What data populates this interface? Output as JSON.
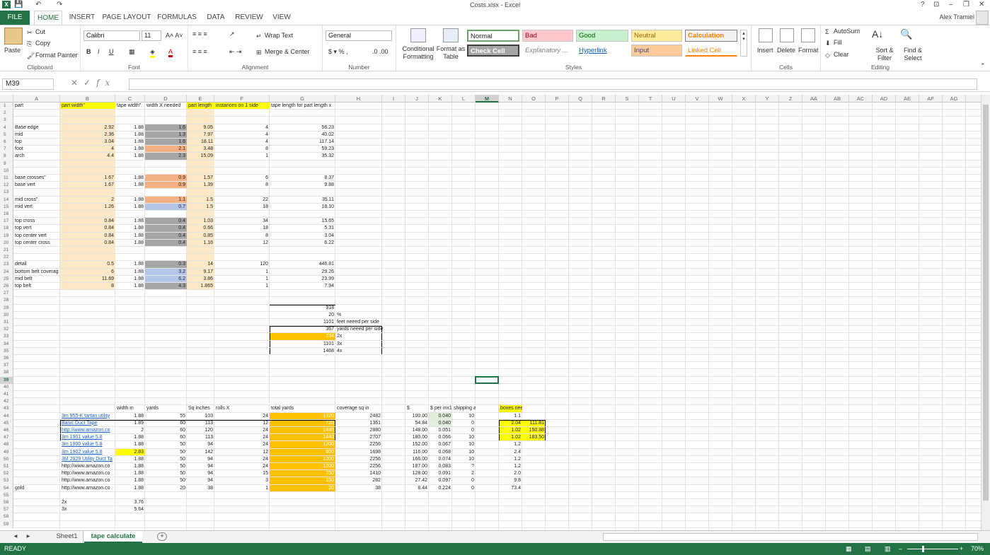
{
  "window": {
    "title": "Costs.xlsx - Excel",
    "help": "?",
    "restore": "⊡",
    "minimize": "–",
    "maximize": "❐",
    "close": "✕"
  },
  "qat": {
    "save": "💾",
    "undo": "↶",
    "redo": "↷"
  },
  "tabs": [
    "FILE",
    "HOME",
    "INSERT",
    "PAGE LAYOUT",
    "FORMULAS",
    "DATA",
    "REVIEW",
    "VIEW"
  ],
  "user": "Alex Tramiel",
  "ribbon": {
    "clipboard": {
      "label": "Clipboard",
      "paste": "Paste",
      "cut": "Cut",
      "copy": "Copy",
      "painter": "Format Painter"
    },
    "font": {
      "label": "Font",
      "name": "Calibri",
      "size": "11"
    },
    "alignment": {
      "label": "Alignment",
      "wrap": "Wrap Text",
      "merge": "Merge & Center"
    },
    "number": {
      "label": "Number",
      "format": "General"
    },
    "styles": {
      "label": "Styles",
      "cond": "Conditional Formatting",
      "table": "Format as Table",
      "normal": "Normal",
      "bad": "Bad",
      "good": "Good",
      "neutral": "Neutral",
      "calculation": "Calculation",
      "check": "Check Cell",
      "explanatory": "Explanatory ...",
      "hyperlink": "Hyperlink",
      "input": "Input",
      "linked": "Linked Cell"
    },
    "cells": {
      "label": "Cells",
      "insert": "Insert",
      "delete": "Delete",
      "format": "Format"
    },
    "editing": {
      "label": "Editing",
      "autosum": "AutoSum",
      "fill": "Fill",
      "clear": "Clear",
      "sort": "Sort & Filter",
      "find": "Find & Select"
    }
  },
  "namebox": "M39",
  "columns": [
    "A",
    "B",
    "C",
    "D",
    "E",
    "F",
    "G",
    "H",
    "I",
    "J",
    "K",
    "L",
    "M",
    "N",
    "O",
    "P",
    "Q",
    "R",
    "S",
    "T",
    "U",
    "V",
    "W",
    "X",
    "Y",
    "Z",
    "AA",
    "AB",
    "AC",
    "AD",
    "AE",
    "AF",
    "AG"
  ],
  "rows": {
    "1": {
      "A": "part",
      "B": "part width\"",
      "C": "tape width\"",
      "D": "width X needed",
      "E": "part length",
      "F": "instances on 1 side",
      "G": "tape length for part length x"
    },
    "4": {
      "A": "Base edge",
      "B": "2.92",
      "C": "1.88",
      "D": "1.6",
      "E": "9.05",
      "F": "4",
      "G": "56.23"
    },
    "5": {
      "A": "mid",
      "B": "2.36",
      "C": "1.88",
      "D": "1.3",
      "E": "7.97",
      "F": "4",
      "G": "40.02"
    },
    "6": {
      "A": "top",
      "B": "3.04",
      "C": "1.88",
      "D": "1.6",
      "E": "18.11",
      "F": "4",
      "G": "117.14"
    },
    "7": {
      "A": "foot",
      "B": "4",
      "C": "1.88",
      "D": "2.1",
      "E": "3.48",
      "F": "8",
      "G": "59.23"
    },
    "8": {
      "A": "arch",
      "B": "4.4",
      "C": "1.88",
      "D": "2.3",
      "E": "15.09",
      "F": "1",
      "G": "35.32"
    },
    "11": {
      "A": "base crosses\"",
      "B": "1.67",
      "C": "1.88",
      "D": "0.9",
      "E": "1.57",
      "F": "6",
      "G": "8.37"
    },
    "12": {
      "A": "base vert",
      "B": "1.67",
      "C": "1.88",
      "D": "0.9",
      "E": "1.39",
      "F": "8",
      "G": "9.88"
    },
    "14": {
      "A": "mid cross\"",
      "B": "2",
      "C": "1.88",
      "D": "1.1",
      "E": "1.5",
      "F": "22",
      "G": "35.11"
    },
    "15": {
      "A": "mid vert",
      "B": "1.26",
      "C": "1.88",
      "D": "0.7",
      "E": "1.5",
      "F": "18",
      "G": "18.10"
    },
    "17": {
      "A": "top cross",
      "B": "0.84",
      "C": "1.88",
      "D": "0.4",
      "E": "1.03",
      "F": "34",
      "G": "15.65"
    },
    "18": {
      "A": "top vert",
      "B": "0.84",
      "C": "1.88",
      "D": "0.4",
      "E": "0.66",
      "F": "18",
      "G": "5.31"
    },
    "19": {
      "A": "top center vert",
      "B": "0.84",
      "C": "1.88",
      "D": "0.4",
      "E": "0.85",
      "F": "8",
      "G": "3.04"
    },
    "20": {
      "A": "top center cross",
      "B": "0.84",
      "C": "1.88",
      "D": "0.4",
      "E": "1.16",
      "F": "12",
      "G": "6.22"
    },
    "23": {
      "A": "detail",
      "B": "0.5",
      "C": "1.88",
      "D": "0.3",
      "E": "14",
      "F": "120",
      "G": "446.81"
    },
    "24": {
      "A": "bottom belt coverag",
      "B": "6",
      "C": "1.88",
      "D": "3.2",
      "E": "9.17",
      "F": "1",
      "G": "29.26"
    },
    "25": {
      "A": "mid belt",
      "B": "11.69",
      "C": "1.88",
      "D": "6.2",
      "E": "3.86",
      "F": "1",
      "G": "23.99"
    },
    "26": {
      "A": "top belt",
      "B": "8",
      "C": "1.88",
      "D": "4.3",
      "E": "1.865",
      "F": "1",
      "G": "7.94"
    },
    "29": {
      "G": "918"
    },
    "30": {
      "G": "20",
      "H": "%"
    },
    "31": {
      "G": "1101",
      "H": "feet neeed per side"
    },
    "32": {
      "G": "367",
      "H": "yards neeed per side"
    },
    "33": {
      "G": "734",
      "H": "2x"
    },
    "34": {
      "G": "1101",
      "H": "3x"
    },
    "35": {
      "G": "1468",
      "H": "4x"
    },
    "43": {
      "C": "width in",
      "D": "yards",
      "E": "Sq inches",
      "F": "rolls X",
      "G": "total yards",
      "H": "coverage sq in",
      "J": "$",
      "K": "$ per inx1",
      "L": "shipping added in",
      "N": "boxes needed for 4x"
    },
    "44": {
      "B": "3m 955-K tartan utility",
      "C": "1.88",
      "D": "55",
      "E": "103",
      "F": "24",
      "G": "1320",
      "H": "2482",
      "J": "100.00",
      "K": "0.040",
      "L": "10",
      "N": "1.1"
    },
    "45": {
      "B": "Basic Duct Tape",
      "C": "1.89",
      "D": "60",
      "E": "113",
      "F": "12",
      "G": "720",
      "H": "1361",
      "J": "54.84",
      "K": "0.040",
      "L": "0",
      "N": "2.04",
      "O": "111.81"
    },
    "46": {
      "B": "http://www.amazon.co",
      "C": "2",
      "D": "60",
      "E": "120",
      "F": "24",
      "G": "1440",
      "H": "2880",
      "J": "148.00",
      "K": "0.051",
      "L": "0",
      "N": "1.02",
      "O": "150.88"
    },
    "47": {
      "B": "3m 1901 value 5.8",
      "C": "1.88",
      "D": "60",
      "E": "113",
      "F": "24",
      "G": "1440",
      "H": "2707",
      "J": "180.00",
      "K": "0.066",
      "L": "10",
      "N": "1.02",
      "O": "183.50"
    },
    "48": {
      "B": "3m 1900 value 5.8",
      "C": "1.88",
      "D": "50",
      "E": "94",
      "F": "24",
      "G": "1200",
      "H": "2256",
      "J": "152.00",
      "K": "0.067",
      "L": "10",
      "N": "1.2"
    },
    "49": {
      "B": "3m 1902 value 5.8",
      "C": "2.83",
      "D": "50",
      "E": "142",
      "F": "12",
      "G": "600",
      "H": "1698",
      "J": "116.00",
      "K": "0.068",
      "L": "10",
      "N": "2.4"
    },
    "50": {
      "B": "3M 2929 Utility Duct Ta",
      "C": "1.88",
      "D": "50",
      "E": "94",
      "F": "24",
      "G": "1200",
      "H": "2256",
      "J": "166.00",
      "K": "0.074",
      "L": "10",
      "N": "1.2"
    },
    "51": {
      "B": "http://www.amazon.co",
      "C": "1.88",
      "D": "50",
      "E": "94",
      "F": "24",
      "G": "1200",
      "H": "2256",
      "J": "187.00",
      "K": "0.083",
      "L": "?",
      "N": "1.2"
    },
    "52": {
      "B": "http://www.amazon.co",
      "C": "1.88",
      "D": "50",
      "E": "94",
      "F": "15",
      "G": "750",
      "H": "1410",
      "J": "128.00",
      "K": "0.091",
      "L": "2",
      "N": "2.0"
    },
    "53": {
      "B": "http://www.amazon.co",
      "C": "1.88",
      "D": "50",
      "E": "94",
      "F": "3",
      "G": "150",
      "H": "282",
      "J": "27.42",
      "K": "0.097",
      "L": "0",
      "N": "9.8"
    },
    "54": {
      "A": "gold",
      "B": "http://www.amazon.co",
      "C": "1.88",
      "D": "20",
      "E": "38",
      "F": "1",
      "G": "20",
      "H": "38",
      "J": "8.44",
      "K": "0.224",
      "L": "0",
      "N": "73.4"
    },
    "56": {
      "B": "2x",
      "C": "3.76"
    },
    "57": {
      "B": "3x",
      "C": "5.64"
    }
  },
  "sheets": [
    "Sheet1",
    "tape calculate"
  ],
  "status": {
    "ready": "READY",
    "zoom": "70%"
  },
  "colors": {
    "accent": "#217346",
    "yellow": "#ffff00",
    "tan": "#fde9c5",
    "gray": "#a6a6a6",
    "salmon": "#f4b183",
    "blue": "#b4c6e7",
    "orange": "#ffc000"
  }
}
